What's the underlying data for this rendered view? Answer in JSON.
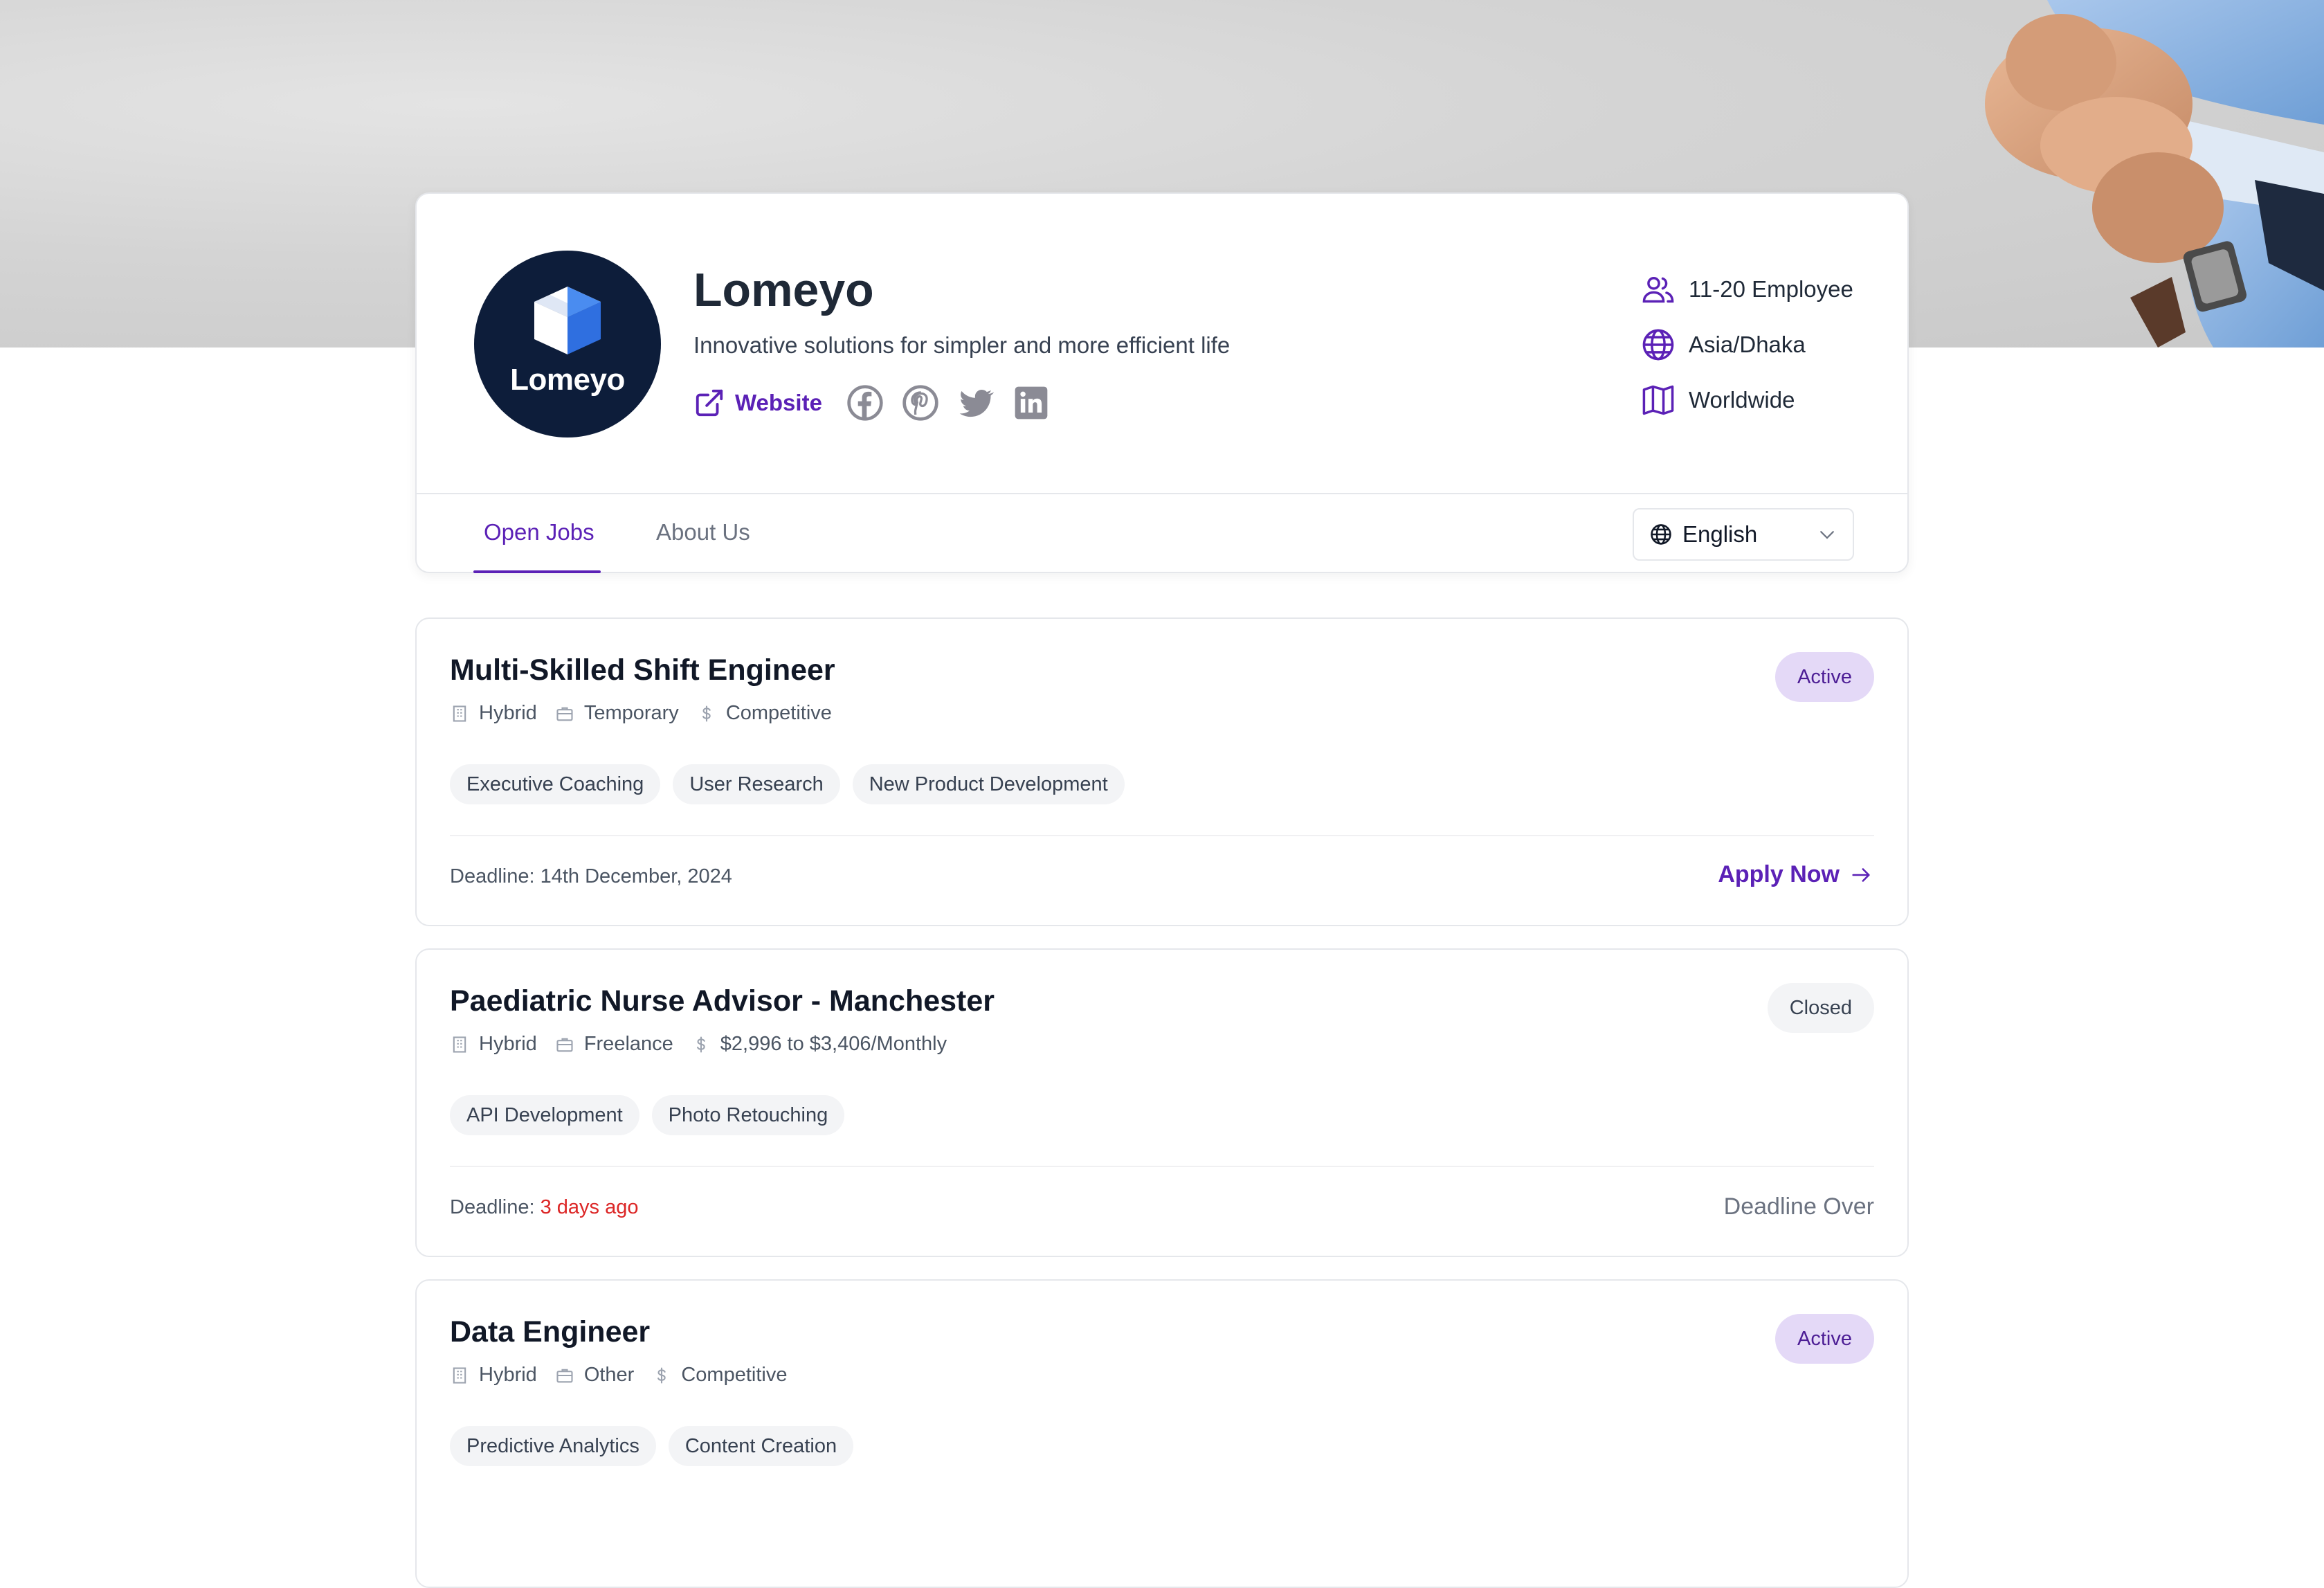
{
  "company": {
    "logo_text": "Lomeyo",
    "name": "Lomeyo",
    "tagline": "Innovative solutions for simpler and more efficient life",
    "website_label": "Website",
    "social": [
      "facebook",
      "pinterest",
      "twitter",
      "linkedin"
    ],
    "meta": {
      "employees": "11-20 Employee",
      "timezone": "Asia/Dhaka",
      "region": "Worldwide"
    }
  },
  "tabs": {
    "open_jobs": "Open Jobs",
    "about_us": "About Us"
  },
  "language": {
    "selected": "English"
  },
  "labels": {
    "deadline": "Deadline: ",
    "apply": "Apply Now",
    "deadline_over": "Deadline Over"
  },
  "jobs": [
    {
      "title": "Multi-Skilled Shift Engineer",
      "workplace": "Hybrid",
      "type": "Temporary",
      "salary": "Competitive",
      "tags": [
        "Executive Coaching",
        "User Research",
        "New Product Development"
      ],
      "deadline": "14th December, 2024",
      "status": "Active"
    },
    {
      "title": "Paediatric Nurse Advisor - Manchester",
      "workplace": "Hybrid",
      "type": "Freelance",
      "salary": "$2,996 to $3,406/Monthly",
      "tags": [
        "API Development",
        "Photo Retouching"
      ],
      "deadline": "3 days ago",
      "status": "Closed"
    },
    {
      "title": "Data Engineer",
      "workplace": "Hybrid",
      "type": "Other",
      "salary": "Competitive",
      "tags": [
        "Predictive Analytics",
        "Content Creation"
      ],
      "status": "Active"
    }
  ],
  "colors": {
    "accent": "#5b21b6",
    "active_badge_bg": "#e4d9f7",
    "overdue": "#dc2626",
    "logo_bg": "#0d1d3a"
  }
}
